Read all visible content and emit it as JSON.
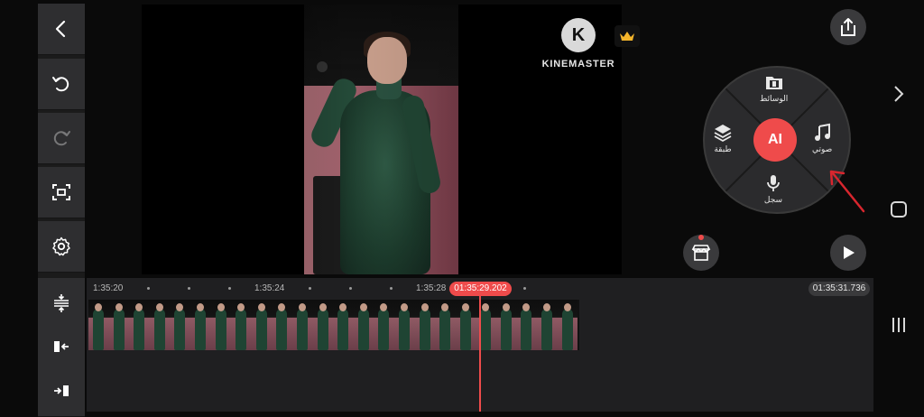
{
  "left_toolbar": {
    "buttons": [
      {
        "name": "back",
        "icon": "chevron-left-icon",
        "enabled": true
      },
      {
        "name": "undo",
        "icon": "undo-icon",
        "enabled": true
      },
      {
        "name": "redo",
        "icon": "redo-icon",
        "enabled": false
      },
      {
        "name": "fullscreen",
        "icon": "fullscreen-icon",
        "enabled": true
      },
      {
        "name": "settings",
        "icon": "gear-icon",
        "enabled": true
      },
      {
        "name": "track-height",
        "icon": "expand-tracks-icon",
        "enabled": true
      },
      {
        "name": "jump-to-start",
        "icon": "jump-start-icon",
        "enabled": true
      },
      {
        "name": "jump-to-end",
        "icon": "jump-end-icon",
        "enabled": true
      }
    ]
  },
  "preview": {
    "watermark_text": "KINEMASTER",
    "watermark_logo_letter": "K",
    "premium_icon": "crown-icon"
  },
  "media_wheel": {
    "center_label": "AI",
    "items": {
      "media": {
        "label": "الوسائط",
        "icon": "film-folder-icon"
      },
      "audio": {
        "label": "صوتي",
        "icon": "music-note-icon"
      },
      "record": {
        "label": "سجل",
        "icon": "microphone-icon"
      },
      "layer": {
        "label": "طبقة",
        "icon": "layers-icon"
      }
    }
  },
  "right_controls": {
    "export_icon": "share-icon",
    "store_icon": "store-icon",
    "play_icon": "play-icon"
  },
  "timeline": {
    "ruler_labels": [
      "1:35:20",
      "1:35:24",
      "1:35:28"
    ],
    "playhead_time": "01:35:29.202",
    "end_time": "01:35:31.736",
    "thumbnail_count": 24
  },
  "system_nav": {
    "forward_icon": "chevron-right-icon",
    "home_icon": "home-square-icon",
    "recents_icon": "recents-icon"
  },
  "colors": {
    "accent": "#ef4b4b",
    "panel": "#2e2e30",
    "wheel": "#2b2b2d"
  }
}
